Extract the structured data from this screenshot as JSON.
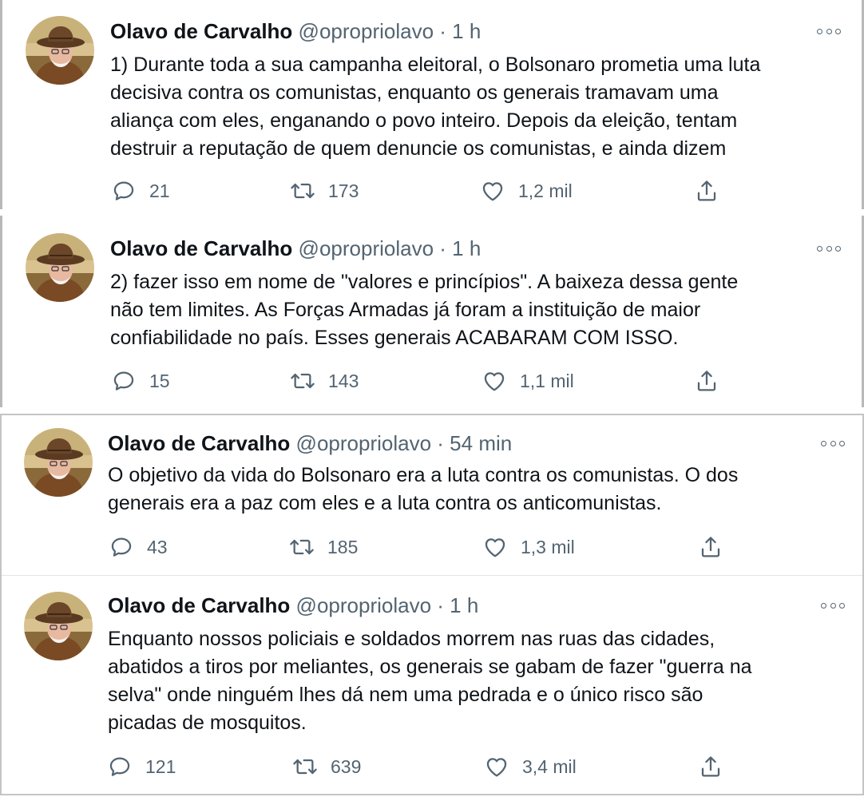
{
  "tweets": [
    {
      "name": "Olavo de Carvalho",
      "handle": "@opropriolavo",
      "separator": "·",
      "time": "1 h",
      "lines": [
        "1) Durante toda a sua campanha eleitoral, o Bolsonaro prometia uma luta",
        "decisiva contra os comunistas, enquanto os generais tramavam uma",
        "aliança com eles, enganando o povo inteiro. Depois da eleição, tentam",
        "destruir a reputação de quem denuncie os comunistas, e ainda dizem"
      ],
      "replies": "21",
      "retweets": "173",
      "likes": "1,2 mil"
    },
    {
      "name": "Olavo de Carvalho",
      "handle": "@opropriolavo",
      "separator": "·",
      "time": "1 h",
      "lines": [
        "2) fazer isso em nome de \"valores e princípios\". A baixeza dessa gente",
        "não tem limites. As Forças Armadas já foram a instituição de maior",
        "confiabilidade no país. Esses generais ACABARAM COM ISSO."
      ],
      "replies": "15",
      "retweets": "143",
      "likes": "1,1 mil"
    },
    {
      "name": "Olavo de Carvalho",
      "handle": "@opropriolavo",
      "separator": "·",
      "time": "54 min",
      "lines": [
        "O objetivo da vida do Bolsonaro era a luta contra os comunistas. O dos",
        "generais era a paz com eles e a luta contra os anticomunistas."
      ],
      "replies": "43",
      "retweets": "185",
      "likes": "1,3 mil"
    },
    {
      "name": "Olavo de Carvalho",
      "handle": "@opropriolavo",
      "separator": "·",
      "time": "1 h",
      "lines": [
        "Enquanto nossos policiais e soldados morrem nas ruas das cidades,",
        "abatidos a tiros por meliantes, os generais se gabam de fazer \"guerra na",
        "selva\" onde ninguém lhes dá nem uma pedrada e o único risco são",
        "picadas de mosquitos."
      ],
      "replies": "121",
      "retweets": "639",
      "likes": "3,4 mil"
    }
  ],
  "icons": {
    "reply": "reply-icon",
    "retweet": "retweet-icon",
    "like": "like-icon",
    "share": "share-icon",
    "more": "more-icon"
  },
  "colors": {
    "text": "#0f1419",
    "secondary": "#536471",
    "border": "#b8b8b8"
  }
}
